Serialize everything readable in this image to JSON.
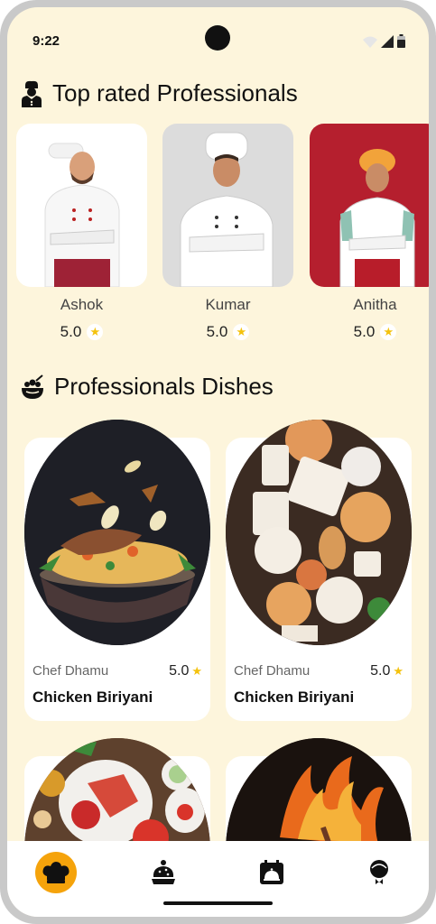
{
  "status_bar": {
    "time": "9:22"
  },
  "top_rated": {
    "title": "Top rated Professionals",
    "icon": "chef-icon",
    "professionals": [
      {
        "name": "Ashok",
        "rating": "5.0"
      },
      {
        "name": "Kumar",
        "rating": "5.0"
      },
      {
        "name": "Anitha",
        "rating": "5.0"
      }
    ]
  },
  "dishes_section": {
    "title": "Professionals Dishes",
    "icon": "food-bowl-icon",
    "dishes": [
      {
        "chef": "Chef Dhamu",
        "rating": "5.0",
        "name": "Chicken Biriyani"
      },
      {
        "chef": "Chef Dhamu",
        "rating": "5.0",
        "name": "Chicken Biriyani"
      },
      {
        "chef": "",
        "rating": "",
        "name": ""
      },
      {
        "chef": "",
        "rating": "",
        "name": ""
      }
    ]
  },
  "bottom_nav": {
    "items": [
      "chef-hat-icon",
      "cake-icon",
      "calendar-icon",
      "waiter-icon"
    ],
    "active_color": "#f5a30b"
  },
  "colors": {
    "background": "#fdf5dc",
    "star": "#f4c20d"
  }
}
